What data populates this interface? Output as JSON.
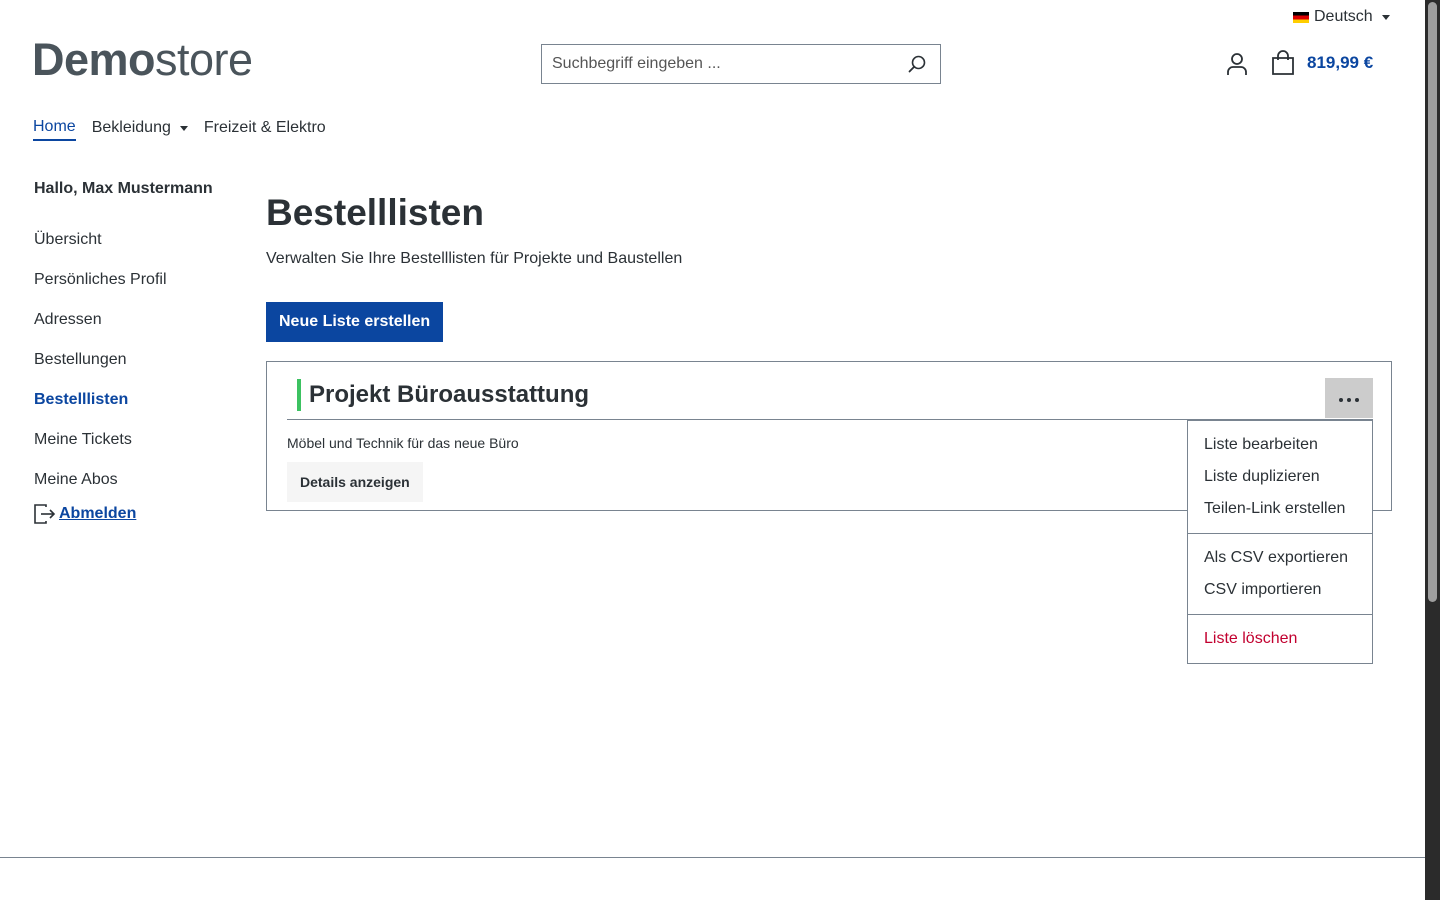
{
  "header": {
    "language": "Deutsch",
    "logo": {
      "bold": "Demo",
      "light": "store"
    },
    "search": {
      "placeholder": "Suchbegriff eingeben ..."
    },
    "cart_total": "819,99 €"
  },
  "mainnav": {
    "items": [
      "Home",
      "Bekleidung",
      "Freizeit & Elektro"
    ]
  },
  "sidebar": {
    "greeting": "Hallo, Max Mustermann",
    "items": [
      "Übersicht",
      "Persönliches Profil",
      "Adressen",
      "Bestellungen",
      "Bestelllisten",
      "Meine Tickets",
      "Meine Abos"
    ],
    "active": "Bestelllisten",
    "logout": "Abmelden"
  },
  "main": {
    "title": "Bestelllisten",
    "subtitle": "Verwalten Sie Ihre Bestelllisten für Projekte und Baustellen",
    "new_list_button": "Neue Liste erstellen",
    "list_card": {
      "title": "Projekt Büroausstattung",
      "description": "Möbel und Technik für das neue Büro",
      "details_button": "Details anzeigen"
    }
  },
  "dropdown": {
    "group1": [
      "Liste bearbeiten",
      "Liste duplizieren",
      "Teilen-Link erstellen"
    ],
    "group2": [
      "Als CSV exportieren",
      "CSV importieren"
    ],
    "danger": "Liste löschen"
  },
  "colors": {
    "brand": "#0b46a0",
    "accent_green": "#3cc261",
    "danger": "#c2002f"
  }
}
